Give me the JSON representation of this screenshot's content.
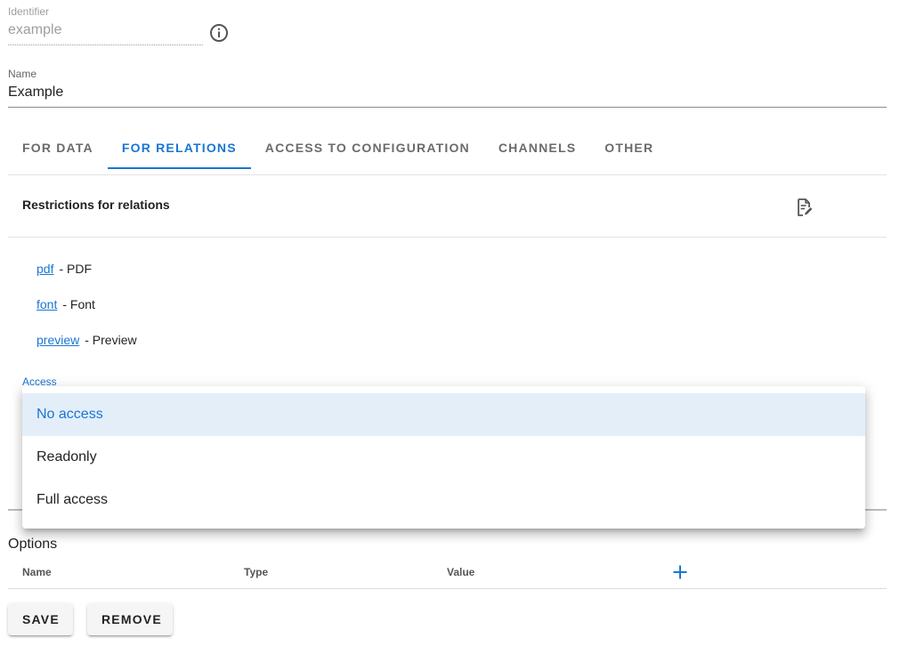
{
  "identifier": {
    "label": "Identifier",
    "value": "example",
    "info_icon": "info-circle-icon"
  },
  "name": {
    "label": "Name",
    "value": "Example"
  },
  "tabs": [
    {
      "label": "FOR DATA"
    },
    {
      "label": "FOR RELATIONS",
      "active": true
    },
    {
      "label": "ACCESS TO CONFIGURATION"
    },
    {
      "label": "CHANNELS"
    },
    {
      "label": "OTHER"
    }
  ],
  "restrictions": {
    "title": "Restrictions for relations",
    "edit_icon": "edit-document-icon",
    "items": [
      {
        "link": "pdf",
        "desc": "- PDF"
      },
      {
        "link": "font",
        "desc": "- Font"
      },
      {
        "link": "preview",
        "desc": "- Preview"
      }
    ]
  },
  "access": {
    "label": "Access",
    "selected": "No access",
    "options": [
      {
        "label": "No access"
      },
      {
        "label": "Readonly"
      },
      {
        "label": "Full access"
      }
    ]
  },
  "options": {
    "title": "Options",
    "columns": [
      "Name",
      "Type",
      "Value"
    ],
    "add_icon": "plus-icon"
  },
  "buttons": {
    "save": "SAVE",
    "remove": "REMOVE"
  },
  "colors": {
    "accent": "#1976d2",
    "selected_bg": "#e3eef9"
  }
}
